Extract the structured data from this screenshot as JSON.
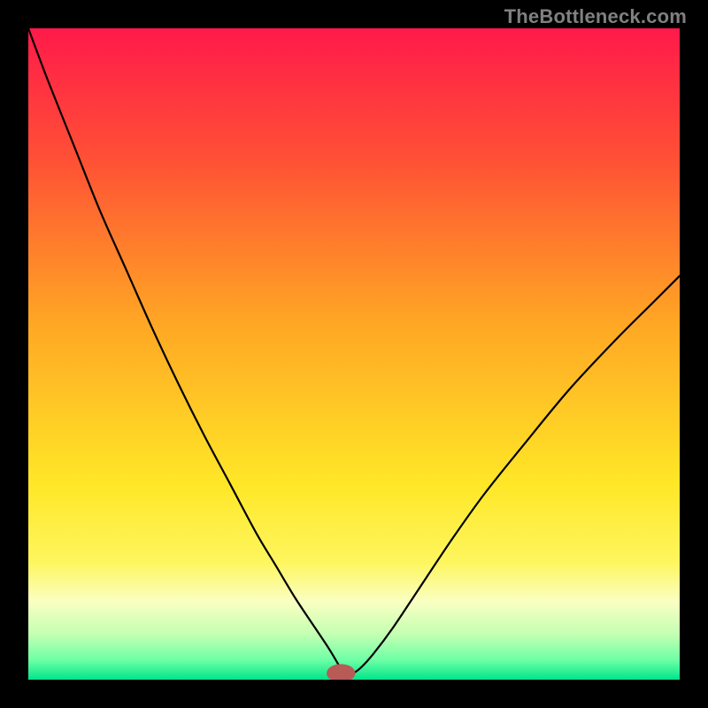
{
  "watermark": "TheBottleneck.com",
  "chart_data": {
    "type": "line",
    "title": "",
    "xlabel": "",
    "ylabel": "",
    "xlim": [
      0,
      100
    ],
    "ylim": [
      0,
      100
    ],
    "background_gradient": {
      "stops": [
        {
          "offset": 0.0,
          "color": "#ff1a4a"
        },
        {
          "offset": 0.2,
          "color": "#ff5035"
        },
        {
          "offset": 0.45,
          "color": "#ffa624"
        },
        {
          "offset": 0.7,
          "color": "#ffe727"
        },
        {
          "offset": 0.82,
          "color": "#fef65f"
        },
        {
          "offset": 0.88,
          "color": "#faffc2"
        },
        {
          "offset": 0.93,
          "color": "#c4ffb3"
        },
        {
          "offset": 0.97,
          "color": "#6dffa5"
        },
        {
          "offset": 1.0,
          "color": "#00e58a"
        }
      ]
    },
    "series": [
      {
        "name": "curve",
        "stroke": "#000000",
        "x": [
          0.0,
          3.0,
          7.0,
          11.0,
          15.0,
          19.0,
          23.0,
          27.0,
          31.0,
          35.0,
          38.0,
          41.0,
          44.0,
          46.0,
          47.5,
          48.0,
          48.5,
          49.5,
          51.0,
          53.0,
          56.0,
          60.0,
          65.0,
          70.0,
          76.0,
          83.0,
          90.0,
          96.0,
          100.0
        ],
        "y": [
          100.0,
          92.0,
          82.0,
          72.0,
          63.0,
          54.0,
          45.5,
          37.5,
          30.0,
          22.5,
          17.5,
          12.5,
          8.0,
          5.0,
          2.5,
          1.5,
          0.8,
          0.8,
          1.8,
          4.0,
          8.0,
          14.0,
          21.5,
          28.5,
          36.0,
          44.5,
          52.0,
          58.0,
          62.0
        ]
      }
    ],
    "marker": {
      "name": "bottleneck-marker",
      "x": 48.0,
      "y": 1.0,
      "rx": 2.2,
      "ry": 1.4,
      "fill": "#b85a55"
    }
  }
}
